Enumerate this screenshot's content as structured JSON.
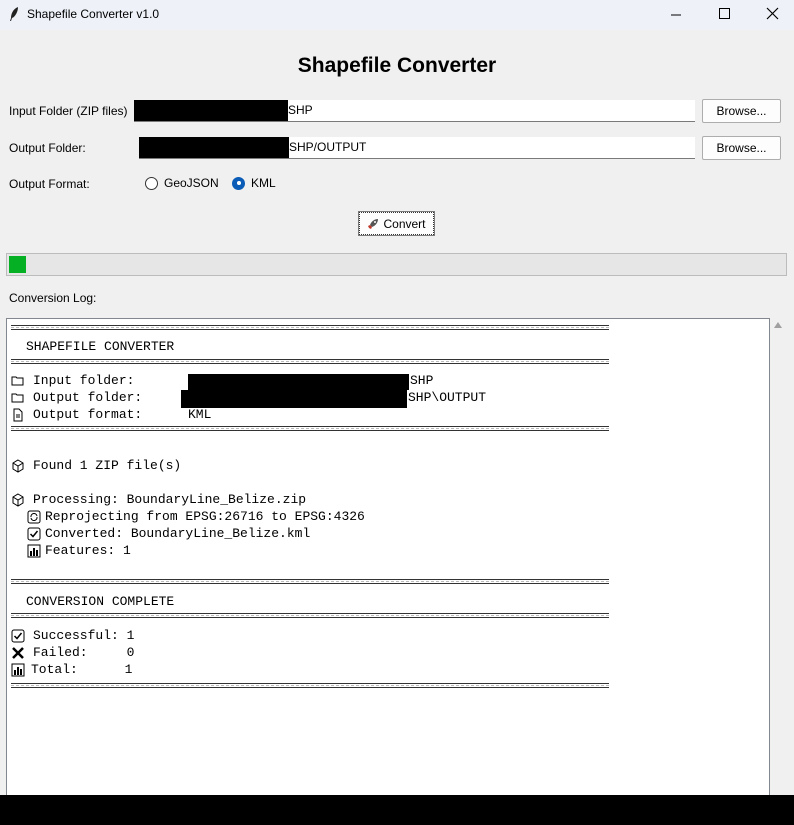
{
  "window": {
    "title": "Shapefile Converter v1.0"
  },
  "app": {
    "heading": "Shapefile Converter"
  },
  "input": {
    "label": "Input Folder (ZIP files)",
    "value_visible": "SHP",
    "browse_label": "Browse..."
  },
  "output": {
    "label": "Output Folder:",
    "value_visible": "SHP/OUTPUT",
    "browse_label": "Browse..."
  },
  "format": {
    "label": "Output Format:",
    "options": [
      "GeoJSON",
      "KML"
    ],
    "selected": "KML"
  },
  "convert": {
    "label": "Convert",
    "icon": "rocket-icon"
  },
  "progress": {
    "percent": 2,
    "color": "#06b025"
  },
  "log": {
    "label": "Conversion Log:",
    "header_title": "SHAPEFILE CONVERTER",
    "input_line_label": "Input folder:",
    "input_line_value": "SHP",
    "output_line_label": "Output folder:",
    "output_line_value": "SHP\\OUTPUT",
    "format_line_label": "Output format:",
    "format_line_value": "KML",
    "found": "Found 1 ZIP file(s)",
    "processing": "Processing: BoundaryLine_Belize.zip",
    "reprojecting": "Reprojecting from EPSG:26716 to EPSG:4326",
    "converted": "Converted: BoundaryLine_Belize.kml",
    "features": "Features: 1",
    "complete_title": "CONVERSION COMPLETE",
    "successful": "Successful: 1",
    "failed": "Failed:     0",
    "total": "Total:      1"
  }
}
